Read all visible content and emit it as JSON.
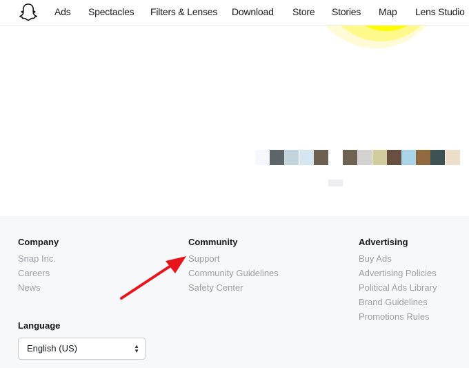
{
  "nav": {
    "items": [
      "Ads",
      "Spectacles",
      "Filters & Lenses",
      "Download",
      "Store",
      "Stories",
      "Map",
      "Lens Studio"
    ]
  },
  "swatches": [
    "#f5f9fd",
    "#5d6569",
    "#c2d4de",
    "#d6e6f1",
    "#6e6050",
    "#ffffff",
    "#6e6352",
    "#d3d2d0",
    "#d0cc9d",
    "#694f41",
    "#aad4e8",
    "#926a40",
    "#3f5253",
    "#ecdec9"
  ],
  "footer": {
    "company": {
      "title": "Company",
      "links": [
        "Snap Inc.",
        "Careers",
        "News"
      ]
    },
    "community": {
      "title": "Community",
      "links": [
        "Support",
        "Community Guidelines",
        "Safety Center"
      ]
    },
    "advertising": {
      "title": "Advertising",
      "links": [
        "Buy Ads",
        "Advertising Policies",
        "Political Ads Library",
        "Brand Guidelines",
        "Promotions Rules"
      ]
    },
    "language": {
      "title": "Language",
      "selected": "English (US)"
    }
  },
  "annotation_color": "#e8141b"
}
